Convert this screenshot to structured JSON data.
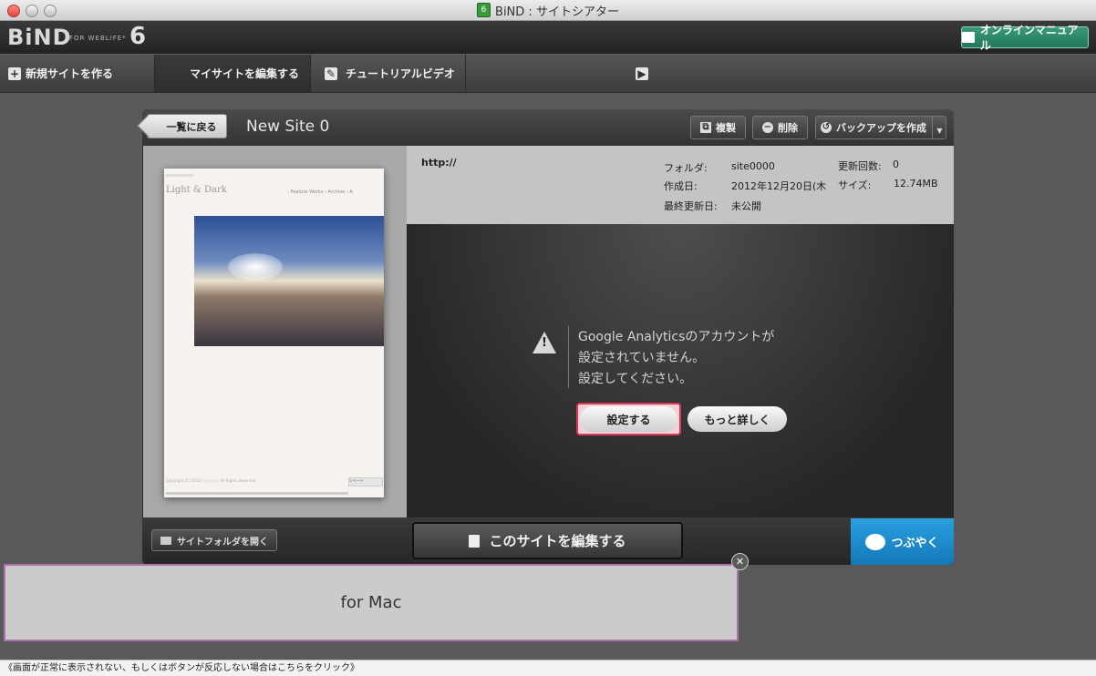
{
  "window": {
    "title": "BiND : サイトシアター"
  },
  "header": {
    "logo": "BiND",
    "logo_sub": "FOR WEBLIFE*",
    "logo_version": "6",
    "manual_button": "オンラインマニュアル"
  },
  "toolbar": {
    "new_site": "新規サイトを作る",
    "edit_my_site": "マイサイトを編集する",
    "tutorial": "チュートリアルビデオ"
  },
  "panel": {
    "back_button": "一覧に戻る",
    "site_name": "New Site 0",
    "duplicate_button": "複製",
    "delete_button": "削除",
    "backup_button": "バックアップを作成"
  },
  "thumbnail": {
    "logo": "Light & Dark",
    "nav": "›  Feature Works     ›  Archive     ›  A",
    "footer": "Copyright (C) 2012 ○○○○○. All Rights Reserved.",
    "tweet": "ツイート"
  },
  "info": {
    "url": "http://",
    "folder_label": "フォルダ:",
    "folder_value": "site0000",
    "created_label": "作成日:",
    "created_value": "2012年12月20日(木",
    "updated_label": "最終更新日:",
    "updated_value": "未公開",
    "update_count_label": "更新回数:",
    "update_count_value": "0",
    "size_label": "サイズ:",
    "size_value": "12.74MB"
  },
  "message": {
    "line1": "Google Analyticsのアカウントが",
    "line2": "設定されていません。",
    "line3": "設定してください。",
    "set_button": "設定する",
    "more_button": "もっと詳しく"
  },
  "bottom": {
    "open_folder": "サイトフォルダを開く",
    "edit_site": "このサイトを編集する",
    "tweet": "つぶやく"
  },
  "popup": {
    "text": "for Mac"
  },
  "status": {
    "text": "《画面が正常に表示されない、もしくはボタンが反応しない場合はこちらをクリック》"
  }
}
